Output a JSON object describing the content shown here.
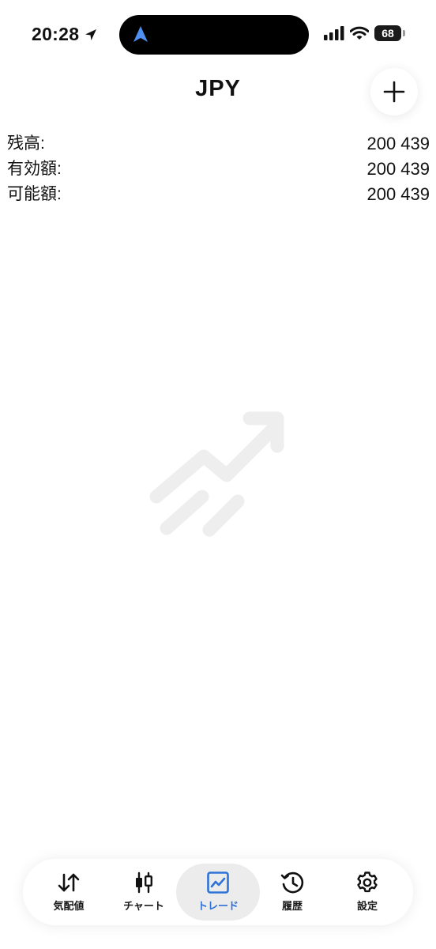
{
  "status_bar": {
    "time": "20:28",
    "battery": "68"
  },
  "header": {
    "title": "JPY"
  },
  "balance": [
    {
      "label": "残高:",
      "value": "200 439"
    },
    {
      "label": "有効額:",
      "value": "200 439"
    },
    {
      "label": "可能額:",
      "value": "200 439"
    }
  ],
  "tabs": [
    {
      "label": "気配値",
      "icon": "quotes-arrows-icon",
      "active": false
    },
    {
      "label": "チャート",
      "icon": "candlestick-icon",
      "active": false
    },
    {
      "label": "トレード",
      "icon": "trade-chart-icon",
      "active": true
    },
    {
      "label": "履歴",
      "icon": "history-clock-icon",
      "active": false
    },
    {
      "label": "設定",
      "icon": "settings-gear-icon",
      "active": false
    }
  ],
  "colors": {
    "accent": "#2f73d9",
    "active_tab_bg": "#ececec",
    "empty_icon": "#eeeeee"
  }
}
